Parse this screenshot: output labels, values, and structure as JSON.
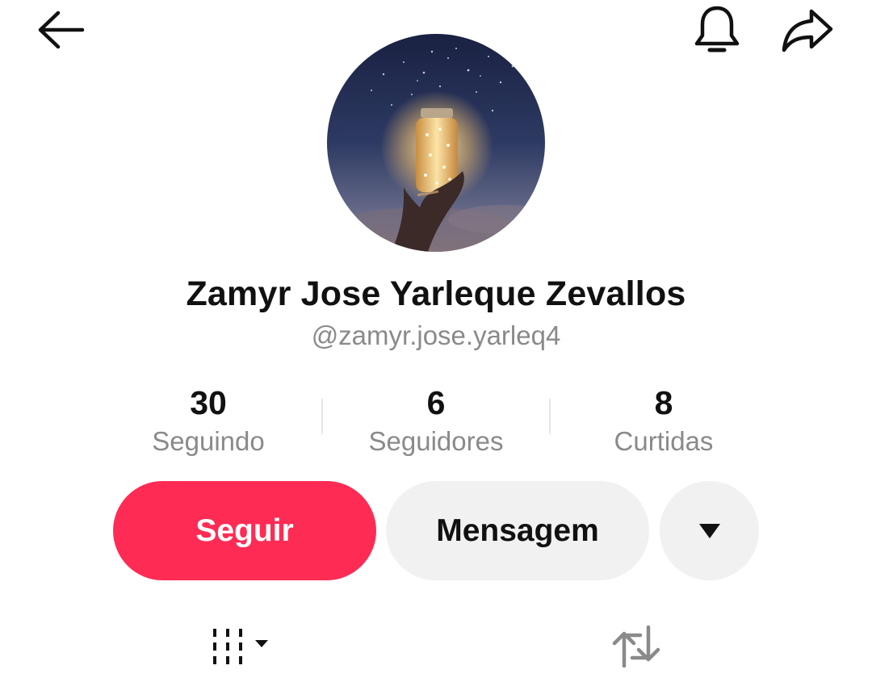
{
  "header": {
    "back_icon": "arrow-left-icon",
    "notification_icon": "bell-icon",
    "share_icon": "share-arrow-icon"
  },
  "profile": {
    "avatar_description_icon": "avatar-image",
    "display_name": "Zamyr Jose Yarleque Zevallos",
    "username": "@zamyr.jose.yarleq4"
  },
  "stats": [
    {
      "value": "30",
      "label": "Seguindo"
    },
    {
      "value": "6",
      "label": "Seguidores"
    },
    {
      "value": "8",
      "label": "Curtidas"
    }
  ],
  "actions": {
    "follow_label": "Seguir",
    "message_label": "Mensagem",
    "more_icon": "triangle-down-icon"
  },
  "tabs": {
    "videos_icon": "grid-lines-dropdown-icon",
    "reposts_icon": "repost-arrows-icon"
  },
  "colors": {
    "follow_button": "#fe2c55",
    "secondary_button": "#f1f1f2",
    "primary_text": "#111111",
    "secondary_text": "#8a8a8a"
  }
}
